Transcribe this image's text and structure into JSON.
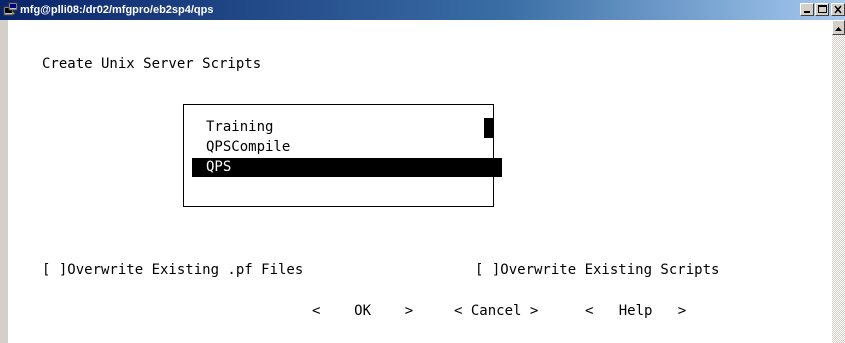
{
  "window": {
    "title": "mfg@plli08:/dr02/mfgpro/eb2sp4/qps",
    "app_icon": "putty-terminal-icon",
    "controls": [
      "minimize-icon",
      "maximize-icon",
      "close-icon"
    ]
  },
  "screen": {
    "title": "Create Unix Server Scripts",
    "list": {
      "items": [
        "Training",
        "QPSCompile",
        "QPS"
      ],
      "selected": "QPS"
    },
    "options": {
      "overwrite_pf": "[ ]Overwrite Existing .pf Files",
      "overwrite_scripts": "[ ]Overwrite Existing Scripts"
    },
    "buttons": {
      "ok": "<    OK    >",
      "cancel": "< Cancel >",
      "help": "<   Help   >"
    }
  },
  "colors": {
    "titlebar_start": "#0a246a",
    "titlebar_end": "#a6caf0",
    "selection_bg": "#000000",
    "selection_fg": "#ffffff",
    "chrome": "#d4d0c8"
  }
}
